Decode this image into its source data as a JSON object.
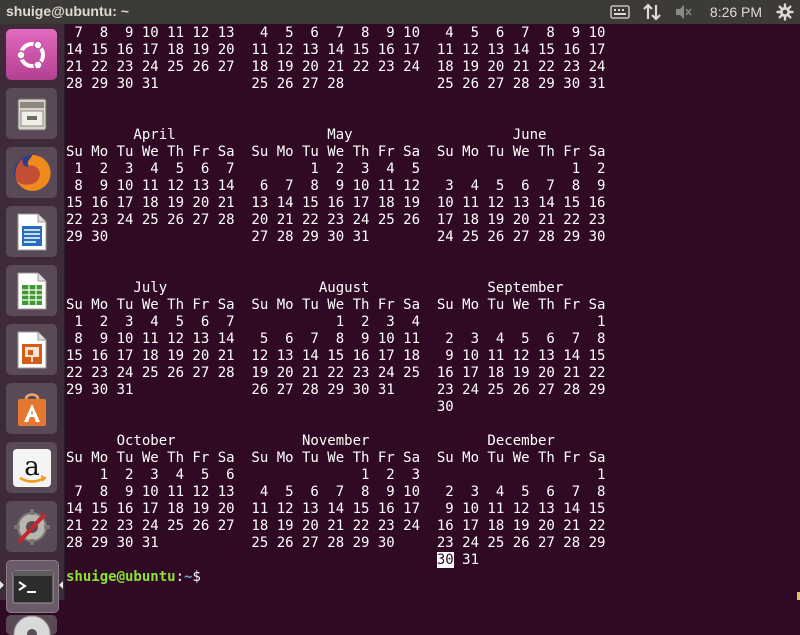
{
  "topbar": {
    "window_title": "shuige@ubuntu: ~",
    "clock": "8:26 PM",
    "indicators": [
      "keyboard-icon",
      "network-icon",
      "volume-muted-icon",
      "gear-icon"
    ]
  },
  "launcher": {
    "items": [
      {
        "name": "ubuntu-dash",
        "icon": "ubuntu-logo-icon"
      },
      {
        "name": "files",
        "icon": "file-cabinet-icon"
      },
      {
        "name": "firefox",
        "icon": "firefox-icon"
      },
      {
        "name": "libreoffice-writer",
        "icon": "writer-icon"
      },
      {
        "name": "libreoffice-calc",
        "icon": "calc-icon"
      },
      {
        "name": "libreoffice-impress",
        "icon": "impress-icon"
      },
      {
        "name": "ubuntu-software",
        "icon": "software-center-icon"
      },
      {
        "name": "amazon",
        "icon": "amazon-icon"
      },
      {
        "name": "system-settings",
        "icon": "settings-icon"
      },
      {
        "name": "terminal",
        "icon": "terminal-icon"
      },
      {
        "name": "dvd",
        "icon": "disc-icon"
      }
    ]
  },
  "terminal": {
    "lines": [
      " 7  8  9 10 11 12 13   4  5  6  7  8  9 10   4  5  6  7  8  9 10",
      "14 15 16 17 18 19 20  11 12 13 14 15 16 17  11 12 13 14 15 16 17",
      "21 22 23 24 25 26 27  18 19 20 21 22 23 24  18 19 20 21 22 23 24",
      "28 29 30 31           25 26 27 28           25 26 27 28 29 30 31",
      "",
      "",
      "        April                  May                   June",
      "Su Mo Tu We Th Fr Sa  Su Mo Tu We Th Fr Sa  Su Mo Tu We Th Fr Sa",
      " 1  2  3  4  5  6  7         1  2  3  4  5                  1  2",
      " 8  9 10 11 12 13 14   6  7  8  9 10 11 12   3  4  5  6  7  8  9",
      "15 16 17 18 19 20 21  13 14 15 16 17 18 19  10 11 12 13 14 15 16",
      "22 23 24 25 26 27 28  20 21 22 23 24 25 26  17 18 19 20 21 22 23",
      "29 30                 27 28 29 30 31        24 25 26 27 28 29 30",
      "",
      "",
      "        July                  August              September",
      "Su Mo Tu We Th Fr Sa  Su Mo Tu We Th Fr Sa  Su Mo Tu We Th Fr Sa",
      " 1  2  3  4  5  6  7            1  2  3  4                     1",
      " 8  9 10 11 12 13 14   5  6  7  8  9 10 11   2  3  4  5  6  7  8",
      "15 16 17 18 19 20 21  12 13 14 15 16 17 18   9 10 11 12 13 14 15",
      "22 23 24 25 26 27 28  19 20 21 22 23 24 25  16 17 18 19 20 21 22",
      "29 30 31              26 27 28 29 30 31     23 24 25 26 27 28 29",
      "                                            30",
      "",
      "      October               November              December",
      "Su Mo Tu We Th Fr Sa  Su Mo Tu We Th Fr Sa  Su Mo Tu We Th Fr Sa",
      "    1  2  3  4  5  6               1  2  3                     1",
      " 7  8  9 10 11 12 13   4  5  6  7  8  9 10   2  3  4  5  6  7  8",
      "14 15 16 17 18 19 20  11 12 13 14 15 16 17   9 10 11 12 13 14 15",
      "21 22 23 24 25 26 27  18 19 20 21 22 23 24  16 17 18 19 20 21 22",
      "28 29 30 31           25 26 27 28 29 30     23 24 25 26 27 28 29"
    ],
    "last_line_pre": "                                            ",
    "today": "30",
    "last_line_post": " 31",
    "prompt_user": "shuige@ubuntu",
    "prompt_sep": ":",
    "prompt_path": "~",
    "prompt_symbol": "$ "
  }
}
